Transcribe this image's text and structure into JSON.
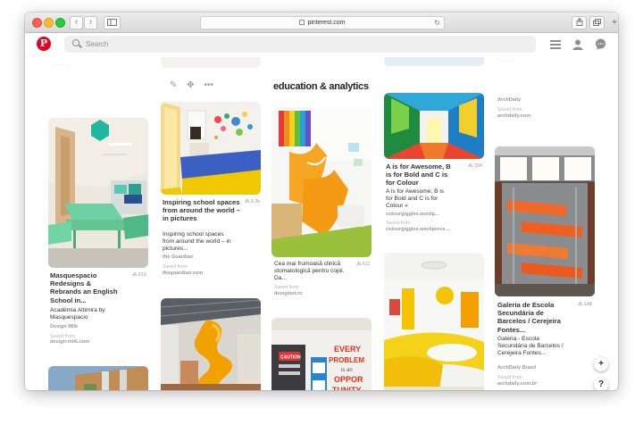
{
  "browser": {
    "url": "pinterest.com"
  },
  "search": {
    "placeholder": "Search"
  },
  "board": {
    "title": "education & analytics"
  },
  "icons": {
    "menu": "menu-icon",
    "profile": "profile-icon",
    "messages": "chat-icon",
    "add": "+",
    "help": "?"
  },
  "pins": [
    {
      "title": "Masquespacio Redesigns & Rebrands an English School in...",
      "count": "619",
      "desc": "Acadèmia Altimira by Masquespacio",
      "source": "Design Milk",
      "saved_label": "Saved from",
      "saved_from": "design-milk.com"
    },
    {
      "title": "Inspiring school spaces from around the world – in pictures",
      "count": "5.3k",
      "desc": "Inspiring school spaces from around the world – in pictures...",
      "source": "the Guardian",
      "saved_label": "Saved from",
      "saved_from": "theguardian.com"
    },
    {
      "title": "",
      "count": "611",
      "desc": "Cea mai frumoasă clinică stomatologică pentru copii. Da...",
      "source": "",
      "saved_label": "Saved from",
      "saved_from": "designist.ro"
    },
    {
      "title": "A is for Awesome, B is for Bold and C is for Colour",
      "count": "334",
      "desc": "A is for Awesome, B is for Bold and C is for Colour «",
      "source": "colourgiggles.wordp...",
      "saved_label": "Saved from",
      "saved_from": "colourgiggles.wordpress...."
    },
    {
      "title": "",
      "count": "",
      "desc": "",
      "source": "ArchDaily",
      "saved_label": "Saved from",
      "saved_from": "archdaily.com"
    },
    {
      "title": "Galeria de Escola Secundária de Barcelos / Cerejeira Fontes...",
      "count": "148",
      "desc": "Galeria - Escola Secundária de Barcelos / Cerejeira Fontes...",
      "source": "ArchDaily Brasil",
      "saved_label": "Saved from",
      "saved_from": "archdaily.com.br"
    }
  ],
  "artwork_text": {
    "poster": "EVERY PROBLEM is an OPPORTUNITY",
    "sign": "CAUTION"
  }
}
